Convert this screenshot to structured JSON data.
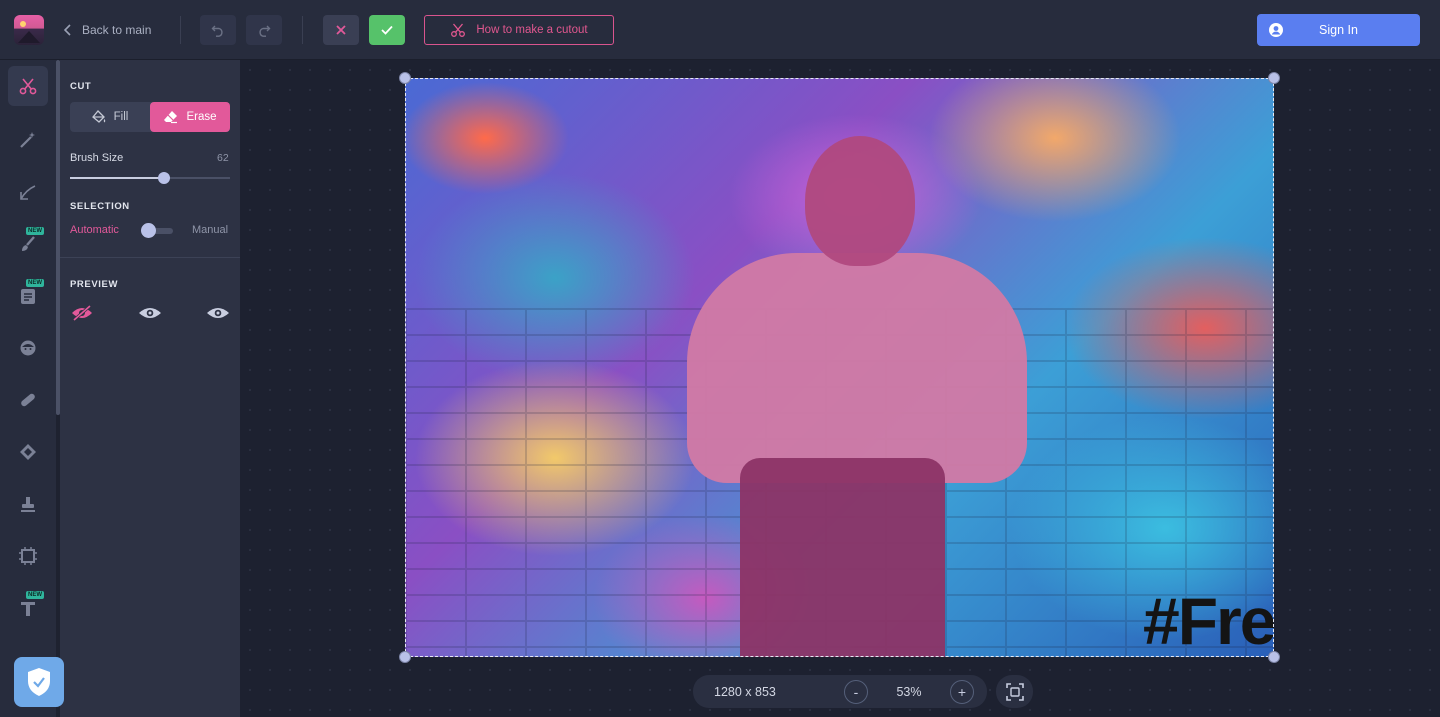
{
  "topbar": {
    "back_label": "Back to main",
    "howto_label": "How to make a cutout",
    "signin_label": "Sign In"
  },
  "icons": {
    "back": "chevron-left-icon",
    "undo": "undo-icon",
    "redo": "redo-icon",
    "cancel": "close-icon",
    "confirm": "check-icon",
    "howto": "scissors-icon",
    "signin": "user-icon"
  },
  "toolrail": {
    "new_tag": "NEW",
    "tools": [
      {
        "name": "cut-tool",
        "icon": "scissors-icon",
        "active": true,
        "new": false
      },
      {
        "name": "magic-wand-tool",
        "icon": "magic-wand-icon",
        "active": false,
        "new": false
      },
      {
        "name": "adjust-tool",
        "icon": "curve-icon",
        "active": false,
        "new": false
      },
      {
        "name": "brush-tool",
        "icon": "brush-icon",
        "active": false,
        "new": true
      },
      {
        "name": "template-tool",
        "icon": "template-icon",
        "active": false,
        "new": true
      },
      {
        "name": "face-tool",
        "icon": "face-icon",
        "active": false,
        "new": false
      },
      {
        "name": "bandage-tool",
        "icon": "bandage-icon",
        "active": false,
        "new": false
      },
      {
        "name": "shape-tool",
        "icon": "diamond-icon",
        "active": false,
        "new": false
      },
      {
        "name": "stamp-tool",
        "icon": "stamp-icon",
        "active": false,
        "new": false
      },
      {
        "name": "frame-tool",
        "icon": "frame-icon",
        "active": false,
        "new": false
      },
      {
        "name": "text-tool",
        "icon": "text-icon",
        "active": false,
        "new": true
      }
    ]
  },
  "panel": {
    "cut_title": "CUT",
    "fill_label": "Fill",
    "erase_label": "Erase",
    "mode_selected": "Erase",
    "brush_size_label": "Brush Size",
    "brush_size_value": "62",
    "brush_size_fraction": 0.59,
    "selection_title": "SELECTION",
    "automatic_label": "Automatic",
    "manual_label": "Manual",
    "selection_mode": "Automatic",
    "preview_title": "PREVIEW",
    "preview_icons": [
      "eye-off-icon",
      "eye-icon",
      "eye-icon"
    ]
  },
  "canvas": {
    "graffiti_text": "#Fre"
  },
  "zoombar": {
    "dimensions": "1280 x 853",
    "zoom": "53%",
    "minus": "-",
    "plus": "+"
  },
  "colors": {
    "accent_pink": "#e2599a",
    "confirm_green": "#56c26a",
    "signin_blue": "#5a7ef0",
    "shield_blue": "#6fa9e8"
  }
}
